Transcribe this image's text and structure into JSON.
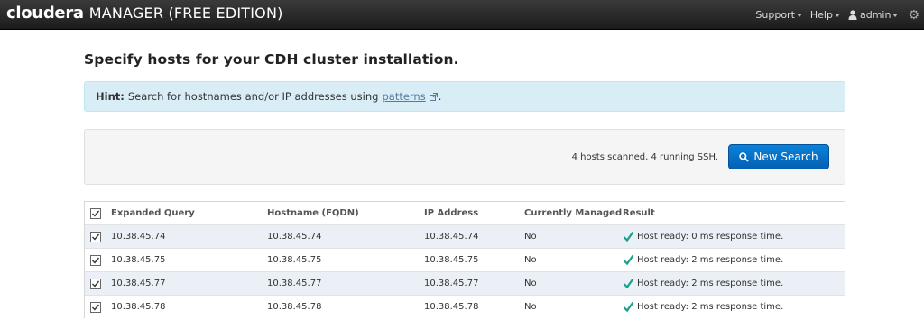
{
  "navbar": {
    "logo_text": "cloudera",
    "product_text": "MANAGER (FREE EDITION)",
    "links": {
      "support": "Support",
      "help": "Help",
      "user": "admin"
    },
    "settings_icon": "gear-icon"
  },
  "page": {
    "title": "Specify hosts for your CDH cluster installation."
  },
  "hint": {
    "label": "Hint:",
    "text": "Search for hostnames and/or IP addresses using",
    "link": "patterns",
    "suffix": "."
  },
  "search": {
    "status": "4 hosts scanned, 4 running SSH.",
    "button_label": "New Search"
  },
  "table": {
    "headers": {
      "expanded_query": "Expanded Query",
      "hostname": "Hostname (FQDN)",
      "ip": "IP Address",
      "managed": "Currently Managed",
      "result": "Result"
    },
    "rows": [
      {
        "query": "10.38.45.74",
        "hostname": "10.38.45.74",
        "ip": "10.38.45.74",
        "managed": "No",
        "result": "Host ready: 0 ms response time.",
        "checked": true
      },
      {
        "query": "10.38.45.75",
        "hostname": "10.38.45.75",
        "ip": "10.38.45.75",
        "managed": "No",
        "result": "Host ready: 2 ms response time.",
        "checked": true
      },
      {
        "query": "10.38.45.77",
        "hostname": "10.38.45.77",
        "ip": "10.38.45.77",
        "managed": "No",
        "result": "Host ready: 2 ms response time.",
        "checked": true
      },
      {
        "query": "10.38.45.78",
        "hostname": "10.38.45.78",
        "ip": "10.38.45.78",
        "managed": "No",
        "result": "Host ready: 2 ms response time.",
        "checked": true
      }
    ]
  },
  "colors": {
    "navbar": "#222222",
    "hint_bg": "#d9edf7",
    "button": "#0a6fc6",
    "row_alt": "#eaf0f6",
    "check": "#1aa08a"
  }
}
